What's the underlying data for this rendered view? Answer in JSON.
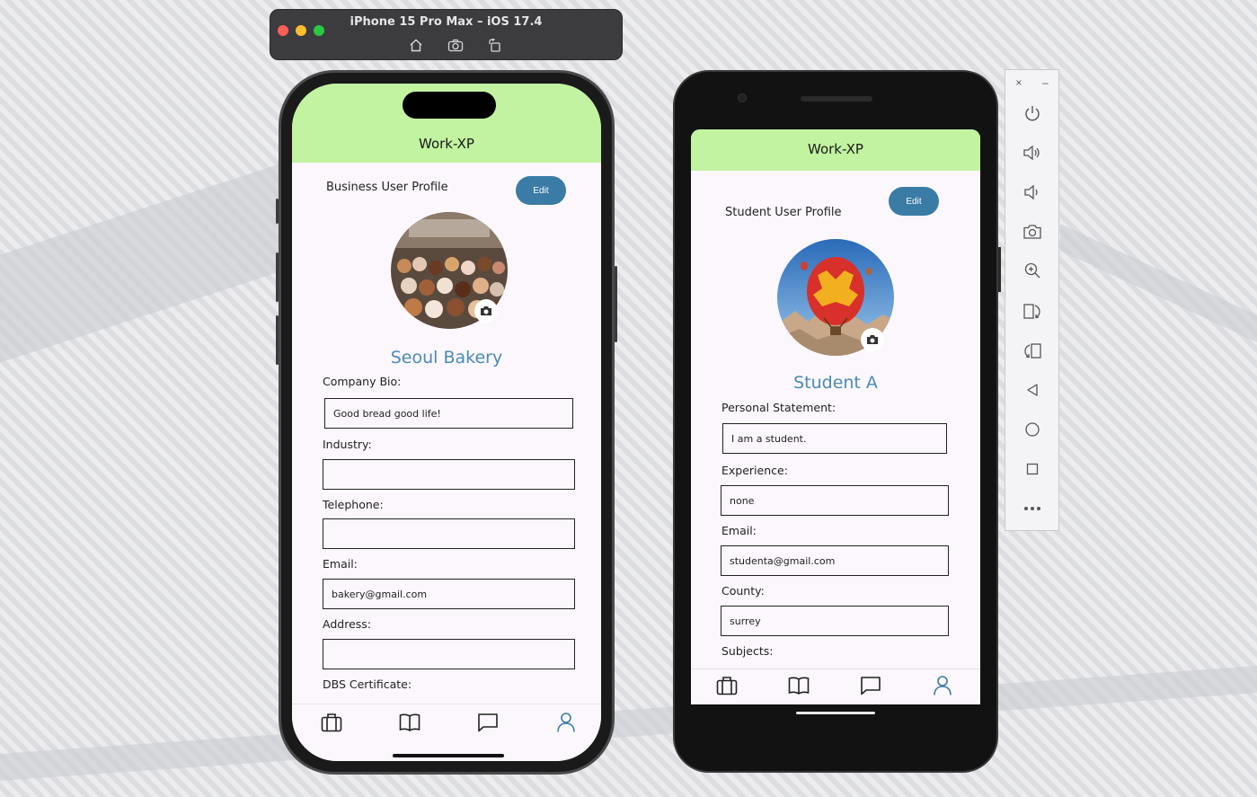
{
  "simulator": {
    "title": "iPhone 15 Pro Max – iOS 17.4",
    "tools": [
      "home-icon",
      "screenshot-icon",
      "rotate-icon"
    ]
  },
  "iphone_app": {
    "app_title": "Work-XP",
    "profile_heading": "Business User Profile",
    "edit_label": "Edit",
    "profile_name": "Seoul Bakery",
    "fields": [
      {
        "label": "Company Bio:",
        "value": ""
      },
      {
        "label": "Industry:",
        "value": ""
      },
      {
        "label": "Telephone:",
        "value": ""
      },
      {
        "label": "Email:",
        "value": "bakery@gmail.com"
      },
      {
        "label": "Address:",
        "value": ""
      },
      {
        "label": "DBS Certificate:",
        "value": ""
      }
    ],
    "bio_value": "Good bread good life!",
    "tabs": [
      "briefcase-icon",
      "book-icon",
      "chat-icon",
      "profile-icon"
    ]
  },
  "android_app": {
    "app_title": "Work-XP",
    "profile_heading": "Student User Profile",
    "edit_label": "Edit",
    "profile_name": "Student A",
    "fields": [
      {
        "label": "Personal Statement:",
        "value": "I am a student."
      },
      {
        "label": "Experience:",
        "value": "none"
      },
      {
        "label": "Email:",
        "value": "studenta@gmail.com"
      },
      {
        "label": "County:",
        "value": "surrey"
      },
      {
        "label": "Subjects:",
        "value": ""
      }
    ],
    "tabs": [
      "briefcase-icon",
      "book-icon",
      "chat-icon",
      "profile-icon"
    ]
  },
  "emulator_panel": {
    "close": "×",
    "minimize": "–",
    "buttons": [
      "power-icon",
      "volume-up-icon",
      "volume-down-icon",
      "camera-icon",
      "zoom-icon",
      "rotate-left-icon",
      "rotate-right-icon",
      "back-icon",
      "home-circle-icon",
      "overview-icon",
      "more-icon"
    ]
  },
  "colors": {
    "appbar": "#c1f3a0",
    "accent": "#3a7ca5",
    "name": "#4a8ab8",
    "active_tab": "#3a7ca5"
  }
}
